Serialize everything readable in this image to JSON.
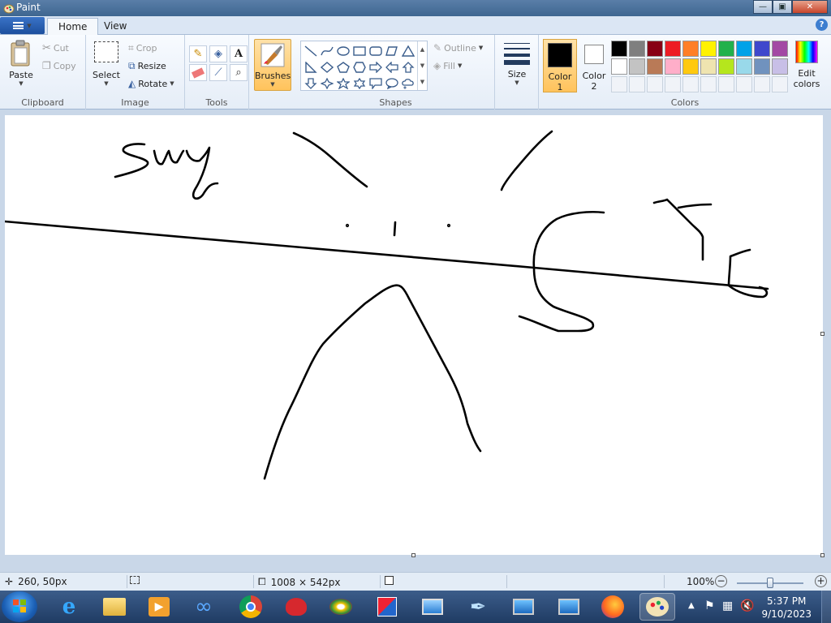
{
  "window": {
    "title": "Paint",
    "minimize": "—",
    "maximize": "▣",
    "close": "✕"
  },
  "tabs": [
    {
      "label": "Home"
    },
    {
      "label": "View"
    }
  ],
  "ribbon": {
    "clipboard": {
      "paste": "Paste",
      "cut": "Cut",
      "copy": "Copy",
      "group": "Clipboard"
    },
    "image": {
      "select": "Select",
      "crop": "Crop",
      "resize": "Resize",
      "rotate": "Rotate",
      "group": "Image"
    },
    "tools": {
      "group": "Tools",
      "text_tool": "A"
    },
    "brushes": {
      "label": "Brushes"
    },
    "shapes": {
      "outline": "Outline",
      "fill": "Fill",
      "group": "Shapes"
    },
    "size": {
      "label": "Size"
    },
    "color1": {
      "line1": "Color",
      "line2": "1",
      "color": "#000000"
    },
    "color2": {
      "line1": "Color",
      "line2": "2",
      "color": "#ffffff"
    },
    "colors": {
      "group": "Colors",
      "edit_line1": "Edit",
      "edit_line2": "colors",
      "palette_row1": [
        "#000000",
        "#7f7f7f",
        "#880015",
        "#ed1c24",
        "#ff7f27",
        "#fff200",
        "#22b14c",
        "#00a2e8",
        "#3f48cc",
        "#a349a4"
      ],
      "palette_row2": [
        "#ffffff",
        "#c3c3c3",
        "#b97a57",
        "#ffaec9",
        "#ffc90e",
        "#efe4b0",
        "#b5e61d",
        "#99d9ea",
        "#7092be",
        "#c8bfe7"
      ]
    }
  },
  "status": {
    "cursor_pos": "260, 50px",
    "canvas_size": "1008 × 542px",
    "zoom": "100%",
    "zoom_level": 0.5
  },
  "taskbar": {
    "time": "5:37 PM",
    "date": "9/10/2023"
  }
}
